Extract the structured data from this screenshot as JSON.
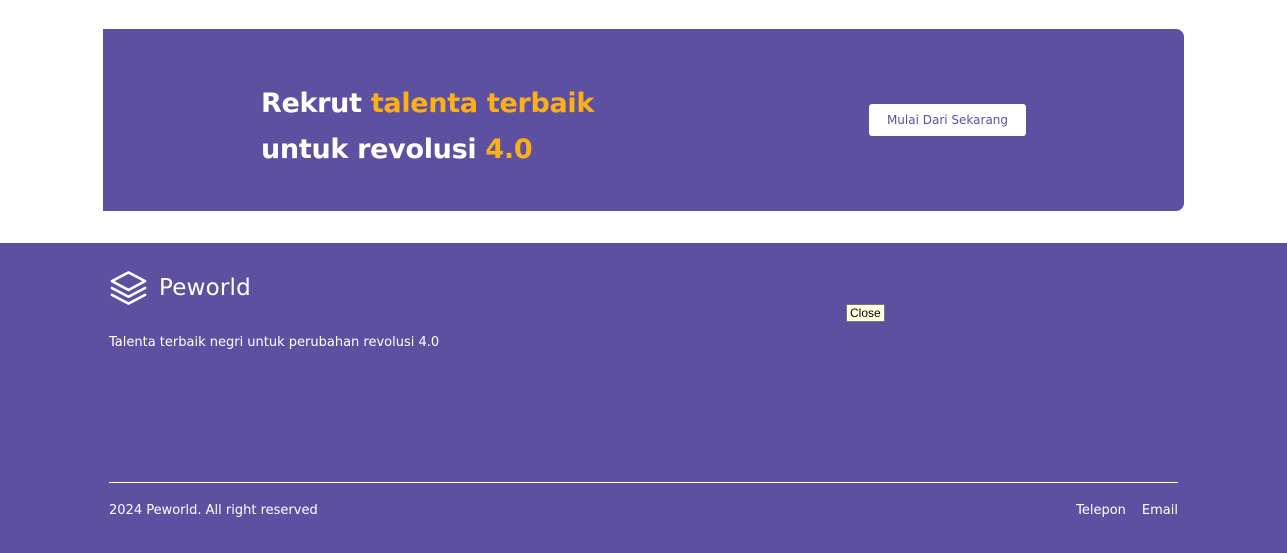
{
  "cta": {
    "title_line1_prefix": "Rekrut ",
    "title_line1_accent": "talenta terbaik",
    "title_line2_prefix": "untuk revolusi ",
    "title_line2_accent": "4.0",
    "button_label": "Mulai Dari Sekarang"
  },
  "footer": {
    "logo_text": "Peworld",
    "logo_icon": "layers-icon",
    "tagline": "Talenta terbaik negri untuk perubahan revolusi 4.0",
    "tooltip": "Close",
    "copyright": "2024 Peworld. All right reserved",
    "links": [
      {
        "label": "Telepon"
      },
      {
        "label": "Email"
      }
    ]
  },
  "colors": {
    "brand": "#5E50A1",
    "accent": "#FBB017",
    "text_light": "#FFFFFF"
  }
}
